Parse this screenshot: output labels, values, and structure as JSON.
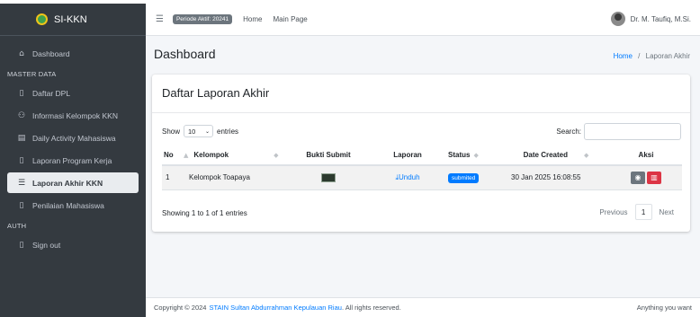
{
  "brand": {
    "name": "SI-KKN"
  },
  "sidebar": {
    "dashboard": "Dashboard",
    "header_master": "MASTER DATA",
    "items": [
      {
        "label": "Daftar DPL",
        "icon": "document-icon"
      },
      {
        "label": "Informasi Kelompok KKN",
        "icon": "users-icon"
      },
      {
        "label": "Daily Activity Mahasiswa",
        "icon": "calendar-icon"
      },
      {
        "label": "Laporan Program Kerja",
        "icon": "file-icon"
      },
      {
        "label": "Laporan Akhir KKN",
        "icon": "list-icon",
        "active": true
      },
      {
        "label": "Penilaian Mahasiswa",
        "icon": "file-icon"
      }
    ],
    "header_auth": "AUTH",
    "signout": "Sign out"
  },
  "topbar": {
    "periode": "Periode Aktif: 20241",
    "links": [
      "Home",
      "Main Page"
    ],
    "user": "Dr. M. Taufiq, M.Si."
  },
  "page": {
    "title": "Dashboard",
    "breadcrumb": {
      "home": "Home",
      "separator": "/",
      "current": "Laporan Akhir"
    }
  },
  "card": {
    "title": "Daftar Laporan Akhir",
    "show_label": "Show",
    "entries_value": "10",
    "entries_label": "entries",
    "search_label": "Search:",
    "columns": [
      "No",
      "Kelompok",
      "Bukti Submit",
      "Laporan",
      "Status",
      "Date Created",
      "Aksi"
    ],
    "rows": [
      {
        "no": "1",
        "kelompok": "Kelompok Toapaya",
        "laporan": "Unduh",
        "status": "submited",
        "date": "30 Jan 2025 16:08:55"
      }
    ],
    "info": "Showing 1 to 1 of 1 entries",
    "pager": {
      "prev": "Previous",
      "page": "1",
      "next": "Next"
    }
  },
  "footer": {
    "copyright": "Copyright © 2024",
    "org": "STAIN Sultan Abdurrahman Kepulauan Riau",
    "rights": ". All rights reserved.",
    "right_text": "Anything you want"
  },
  "colors": {
    "sidebar": "#343a40",
    "primary": "#007bff",
    "danger": "#dc3545",
    "secondary": "#6c757d"
  }
}
